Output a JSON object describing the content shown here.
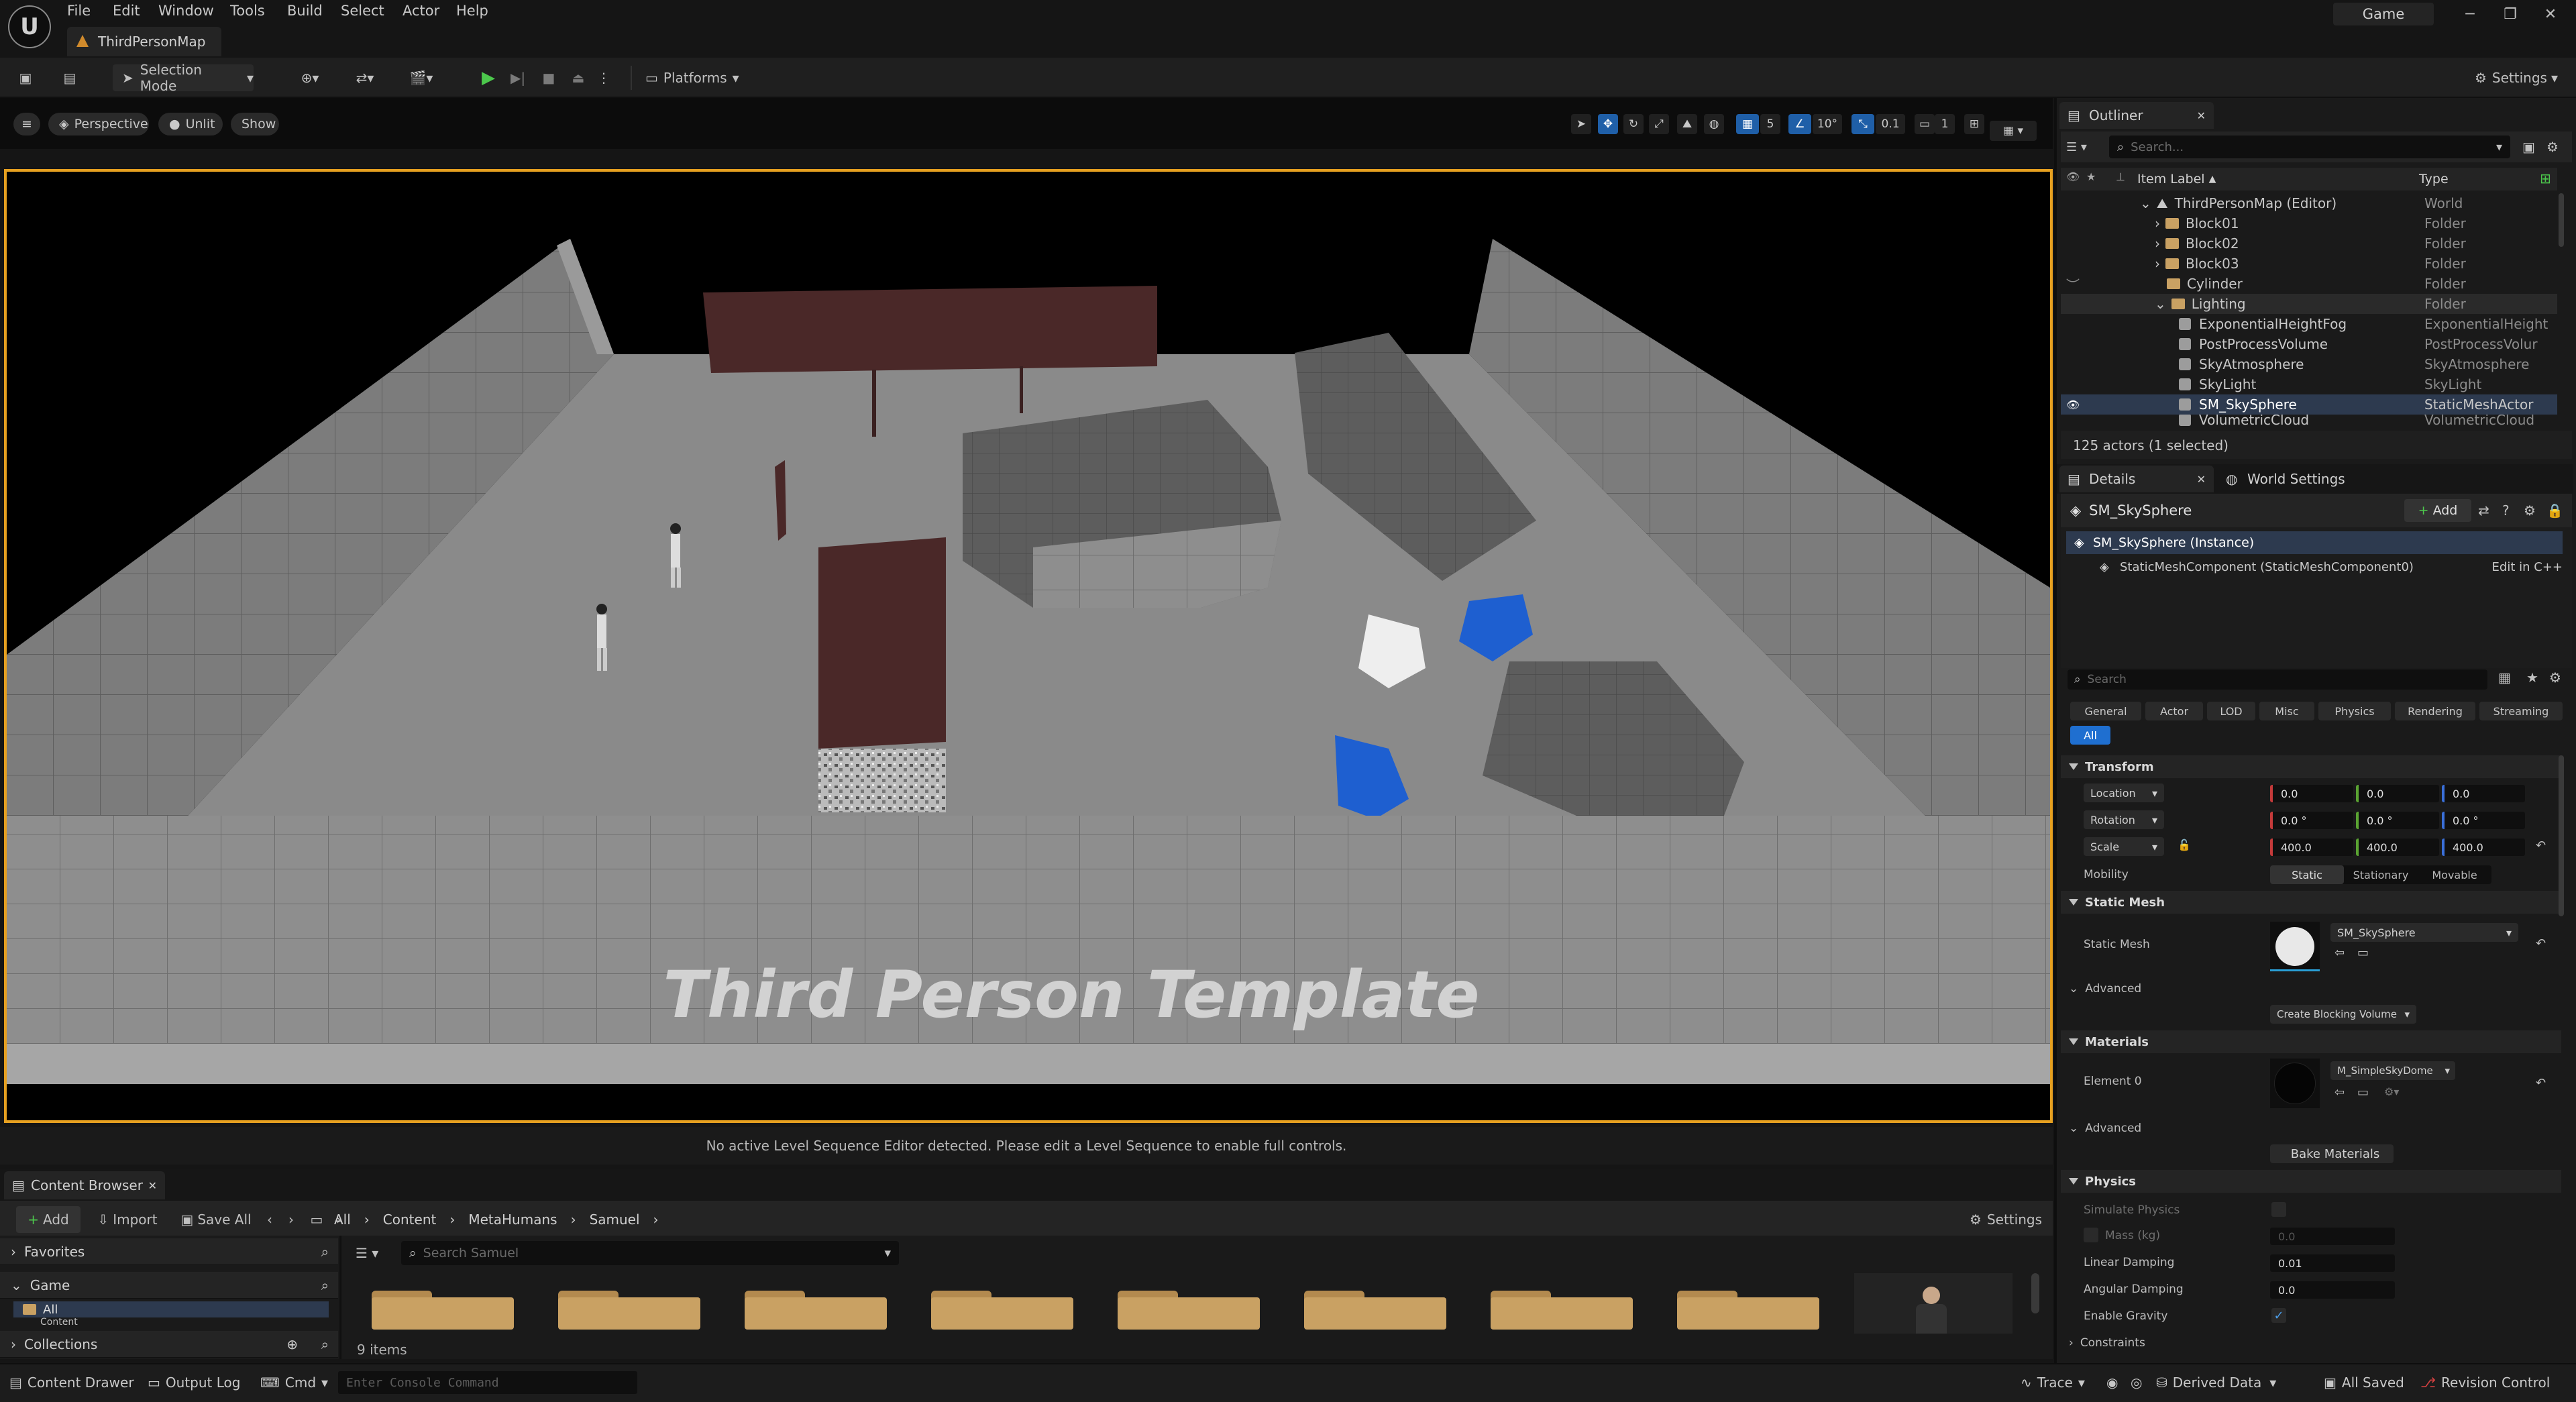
{
  "app": {
    "logo": "U",
    "map_tab": "ThirdPersonMap",
    "context": "Game",
    "menu": [
      "File",
      "Edit",
      "Window",
      "Tools",
      "Build",
      "Select",
      "Actor",
      "Help"
    ]
  },
  "toolbar": {
    "selection_mode": "Selection Mode",
    "platforms": "Platforms",
    "settings": "Settings"
  },
  "viewport_header": {
    "perspective": "Perspective",
    "unlit": "Unlit",
    "show": "Show",
    "grid_value": "5",
    "angle_value": "10°",
    "scale_value": "0.1",
    "camera_speed": "1"
  },
  "viewport": {
    "overlay_text": "Third Person Template"
  },
  "sequence_message": "No active Level Sequence Editor detected. Please edit a Level Sequence to enable full controls.",
  "content_browser": {
    "tab": "Content Browser",
    "add": "Add",
    "import": "Import",
    "save_all": "Save All",
    "breadcrumb": [
      "All",
      "Content",
      "MetaHumans",
      "Samuel"
    ],
    "settings": "Settings",
    "search_placeholder": "Search Samuel",
    "favorites": "Favorites",
    "game": "Game",
    "tree_all": "All",
    "tree_content": "Content",
    "collections": "Collections",
    "item_count": "9 items"
  },
  "statusbar": {
    "content_drawer": "Content Drawer",
    "output_log": "Output Log",
    "cmd": "Cmd",
    "console_placeholder": "Enter Console Command",
    "trace": "Trace",
    "derived_data": "Derived Data",
    "all_saved": "All Saved",
    "revision_control": "Revision Control"
  },
  "outliner": {
    "tab": "Outliner",
    "search_placeholder": "Search...",
    "col_label": "Item Label",
    "col_type": "Type",
    "rows": [
      {
        "label": "ThirdPersonMap (Editor)",
        "type": "World"
      },
      {
        "label": "Block01",
        "type": "Folder"
      },
      {
        "label": "Block02",
        "type": "Folder"
      },
      {
        "label": "Block03",
        "type": "Folder"
      },
      {
        "label": "Cylinder",
        "type": "Folder"
      },
      {
        "label": "Lighting",
        "type": "Folder"
      },
      {
        "label": "ExponentialHeightFog",
        "type": "ExponentialHeight"
      },
      {
        "label": "PostProcessVolume",
        "type": "PostProcessVolur"
      },
      {
        "label": "SkyAtmosphere",
        "type": "SkyAtmosphere"
      },
      {
        "label": "SkyLight",
        "type": "SkyLight"
      },
      {
        "label": "SM_SkySphere",
        "type": "StaticMeshActor"
      },
      {
        "label": "VolumetricCloud",
        "type": "VolumetricCloud"
      }
    ],
    "actor_count": "125 actors (1 selected)"
  },
  "details": {
    "tab": "Details",
    "world_settings_tab": "World Settings",
    "actor_name": "SM_SkySphere",
    "add": "Add",
    "instance": "SM_SkySphere (Instance)",
    "component": "StaticMeshComponent (StaticMeshComponent0)",
    "edit_cpp": "Edit in C++",
    "search_placeholder": "Search",
    "filters": [
      "General",
      "Actor",
      "LOD",
      "Misc",
      "Physics",
      "Rendering",
      "Streaming"
    ],
    "filter_all": "All",
    "transform": {
      "section": "Transform",
      "location": "Location",
      "rotation": "Rotation",
      "scale": "Scale",
      "loc": [
        "0.0",
        "0.0",
        "0.0"
      ],
      "rot": [
        "0.0 °",
        "0.0 °",
        "0.0 °"
      ],
      "scl": [
        "400.0",
        "400.0",
        "400.0"
      ],
      "mobility": "Mobility",
      "mob_options": [
        "Static",
        "Stationary",
        "Movable"
      ]
    },
    "static_mesh": {
      "section": "Static Mesh",
      "label": "Static Mesh",
      "value": "SM_SkySphere",
      "advanced": "Advanced",
      "blocking": "Create Blocking Volume"
    },
    "materials": {
      "section": "Materials",
      "element": "Element 0",
      "value": "M_SimpleSkyDome",
      "advanced": "Advanced",
      "bake": "Bake Materials"
    },
    "physics": {
      "section": "Physics",
      "simulate": "Simulate Physics",
      "mass": "Mass (kg)",
      "mass_value": "0.0",
      "linear": "Linear Damping",
      "linear_value": "0.01",
      "angular": "Angular Damping",
      "angular_value": "0.0",
      "gravity": "Enable Gravity",
      "constraints": "Constraints"
    }
  }
}
